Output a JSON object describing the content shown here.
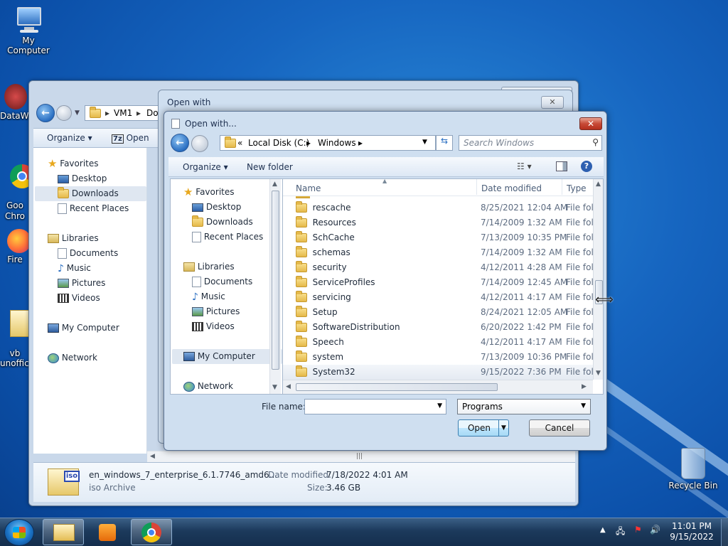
{
  "desktop": {
    "icons": [
      {
        "label": "My Computer"
      },
      {
        "label": "DataWa"
      },
      {
        "label": "Goo\nChro"
      },
      {
        "label": "Fire"
      },
      {
        "label": "vb\nunoffici"
      },
      {
        "label": "Recycle Bin"
      }
    ]
  },
  "back_window": {
    "breadcrumb": [
      "VM1",
      "Do"
    ],
    "organize": "Organize",
    "open": "Open",
    "nav": {
      "favorites": "Favorites",
      "desktop": "Desktop",
      "downloads": "Downloads",
      "recent": "Recent Places",
      "libraries": "Libraries",
      "documents": "Documents",
      "music": "Music",
      "pictures": "Pictures",
      "videos": "Videos",
      "mycomputer": "My Computer",
      "network": "Network"
    },
    "details": {
      "filename": "en_windows_7_enterprise_6.1.7746_amd6...",
      "filetype": "iso Archive",
      "date_label": "Date modified:",
      "date_value": "7/18/2022 4:01 AM",
      "size_label": "Size:",
      "size_value": "3.46 GB",
      "badge": "iso"
    }
  },
  "openwith_window": {
    "title": "Open with"
  },
  "dialog": {
    "title": "Open with...",
    "address": {
      "prefix": "«",
      "crumbs": [
        "Local Disk (C:)",
        "Windows"
      ]
    },
    "search_placeholder": "Search Windows",
    "organize": "Organize",
    "new_folder": "New folder",
    "nav": {
      "favorites": "Favorites",
      "desktop": "Desktop",
      "downloads": "Downloads",
      "recent": "Recent Places",
      "libraries": "Libraries",
      "documents": "Documents",
      "music": "Music",
      "pictures": "Pictures",
      "videos": "Videos",
      "mycomputer": "My Computer",
      "network": "Network"
    },
    "columns": {
      "name": "Name",
      "date": "Date modified",
      "type": "Type"
    },
    "rows": [
      {
        "name": "rescache",
        "date": "8/25/2021 12:04 AM",
        "type": "File fol"
      },
      {
        "name": "Resources",
        "date": "7/14/2009 1:32 AM",
        "type": "File fol"
      },
      {
        "name": "SchCache",
        "date": "7/13/2009 10:35 PM",
        "type": "File fol"
      },
      {
        "name": "schemas",
        "date": "7/14/2009 1:32 AM",
        "type": "File fol"
      },
      {
        "name": "security",
        "date": "4/12/2011 4:28 AM",
        "type": "File fol"
      },
      {
        "name": "ServiceProfiles",
        "date": "7/14/2009 12:45 AM",
        "type": "File fol"
      },
      {
        "name": "servicing",
        "date": "4/12/2011 4:17 AM",
        "type": "File fol"
      },
      {
        "name": "Setup",
        "date": "8/24/2021 12:05 AM",
        "type": "File fol"
      },
      {
        "name": "SoftwareDistribution",
        "date": "6/20/2022 1:42 PM",
        "type": "File fol"
      },
      {
        "name": "Speech",
        "date": "4/12/2011 4:17 AM",
        "type": "File fol"
      },
      {
        "name": "system",
        "date": "7/13/2009 10:36 PM",
        "type": "File fol"
      },
      {
        "name": "System32",
        "date": "9/15/2022 7:36 PM",
        "type": "File fol"
      }
    ],
    "filename_label": "File name:",
    "filename_value": "",
    "filter": "Programs",
    "open_btn": "Open",
    "cancel_btn": "Cancel"
  },
  "taskbar": {
    "time": "11:01 PM",
    "date": "9/15/2022"
  },
  "colors": {
    "accent": "#1665c0",
    "close_red": "#c74a37",
    "selection": "#dfe7f1"
  }
}
